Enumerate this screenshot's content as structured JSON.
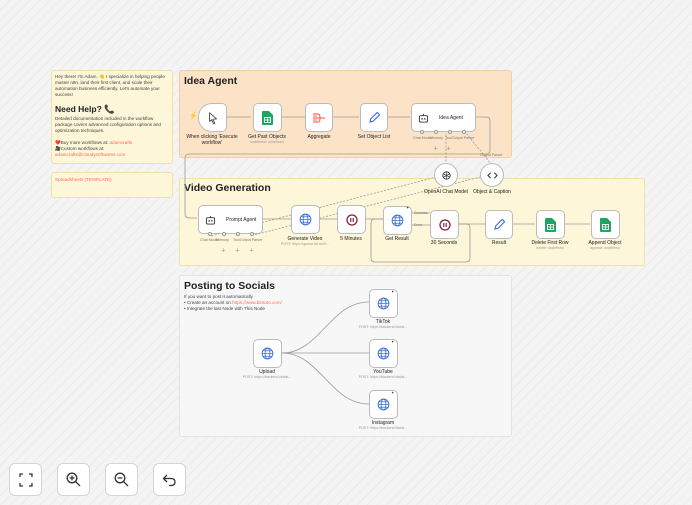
{
  "notes": {
    "intro": {
      "greeting": "Hey there! I'm Adam. 👋 I specialize in helping people master n8n, land their first client, and scale their automation business efficiently. Let's automate your success!",
      "help_title": "Need Help? 📞",
      "help_body": "Detailed documentation included in the workflow package covers advanced configuration options and optimization techniques.",
      "more_label": "❤️Buy more workflows at:",
      "more_link": "adamcrafts",
      "custom_label": "🎥Custom workflows at:",
      "custom_link": "adamcrafts@cloudysoftwares.com"
    },
    "sheet_link": "Spreadsheets (TEMPLATE)",
    "colors": {
      "yellow_note": "#fdf6d8",
      "orange_note": "#fce3c7",
      "accent": "#ff6d5a"
    }
  },
  "sections": {
    "idea": "Idea Agent",
    "video": "Video Generation",
    "social": {
      "title": "Posting to Socials",
      "line1": "If you want to post it automatically",
      "line2_prefix": "• Create an account on ",
      "line2_link": "https://www.blotato.com/",
      "line3": "• Integrate the last Node with This Node"
    }
  },
  "nodes": {
    "trigger": {
      "label": "When clicking 'Execute workflow'",
      "icon": "cursor-icon"
    },
    "get_past": {
      "label": "Get Past Objects",
      "sub": "undefined: undefined",
      "icon": "google-sheets-icon"
    },
    "aggregate": {
      "label": "Aggregate",
      "icon": "aggregate-icon"
    },
    "set_object": {
      "label": "Set Object List",
      "icon": "pencil-icon"
    },
    "idea_agent": {
      "label": "Idea Agent",
      "icon": "robot-icon",
      "ports": [
        "Chat Model",
        "Memory",
        "Tool",
        "Output Parser"
      ]
    },
    "openai": {
      "label": "OpenAI Chat Model",
      "icon": "openai-icon"
    },
    "obj_caption": {
      "label": "Object & Caption",
      "icon": "code-icon"
    },
    "prompt_agent": {
      "label": "Prompt Agent",
      "icon": "robot-icon",
      "ports": [
        "Chat Model",
        "Memory",
        "Tool",
        "Output Parser"
      ]
    },
    "generate_video": {
      "label": "Generate Video",
      "sub": "POST: https://queue.fal.run/f...",
      "icon": "globe-icon"
    },
    "wait5": {
      "label": "5 Minutes",
      "icon": "pause-icon"
    },
    "get_result": {
      "label": "Get Result",
      "icon": "globe-icon",
      "ports": [
        "Success",
        "Error"
      ]
    },
    "wait30": {
      "label": "30 Seconds",
      "icon": "pause-icon"
    },
    "result": {
      "label": "Result",
      "icon": "pencil-icon"
    },
    "delete_row": {
      "label": "Delete First Row",
      "sub": "delete: undefined",
      "icon": "google-sheets-icon"
    },
    "append": {
      "label": "Append Object",
      "sub": "append: undefined",
      "icon": "google-sheets-icon"
    },
    "upload": {
      "label": "Upload",
      "sub": "POST: https://backend.blotat...",
      "icon": "globe-icon"
    },
    "tiktok": {
      "label": "TikTok",
      "sub": "POST: https://backend.blotat...",
      "icon": "globe-icon"
    },
    "youtube": {
      "label": "YouTube",
      "sub": "POST: https://backend.blotat...",
      "icon": "globe-icon"
    },
    "instagram": {
      "label": "Instagram",
      "sub": "POST: https://backend.blotat...",
      "icon": "globe-icon"
    }
  },
  "controls": [
    {
      "name": "fit-view-button",
      "icon": "fit-view-icon"
    },
    {
      "name": "zoom-in-button",
      "icon": "zoom-in-icon"
    },
    {
      "name": "zoom-out-button",
      "icon": "zoom-out-icon"
    },
    {
      "name": "undo-button",
      "icon": "undo-icon"
    }
  ]
}
